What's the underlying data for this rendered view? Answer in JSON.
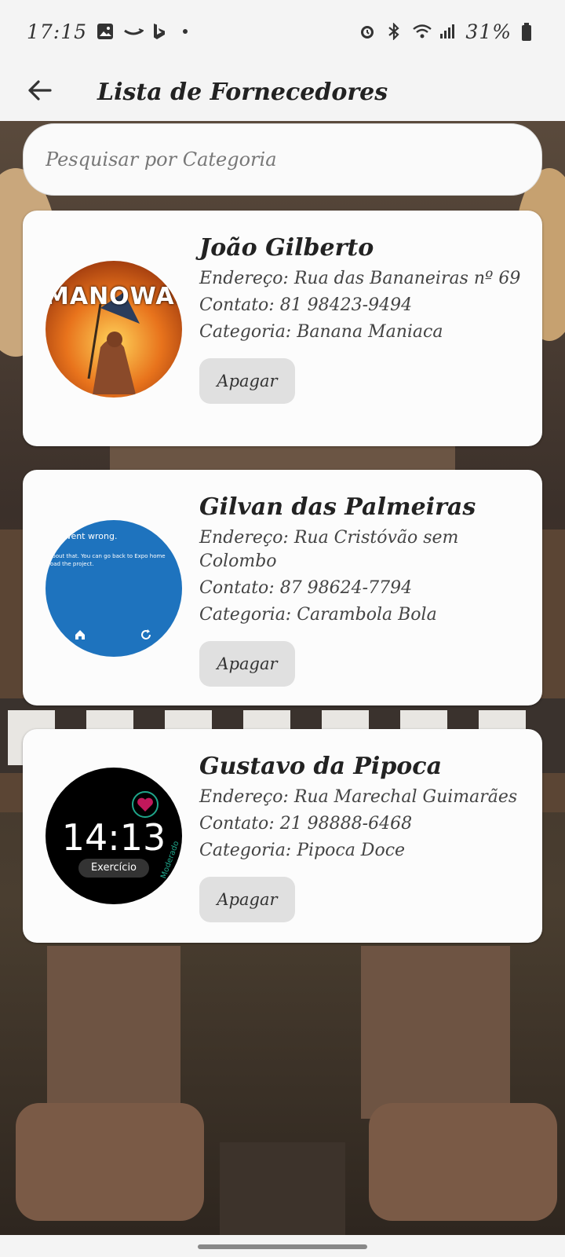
{
  "status_bar": {
    "time": "17:15",
    "battery": "31%",
    "icons_left": [
      "gallery-icon",
      "amazon-icon",
      "bing-icon",
      "dot-icon"
    ],
    "icons_right": [
      "alarm-icon",
      "bluetooth-icon",
      "wifi-icon",
      "signal-icon",
      "battery-icon"
    ]
  },
  "app_bar": {
    "title": "Lista de Fornecedores",
    "back_icon": "arrow-left-icon"
  },
  "search": {
    "placeholder": "Pesquisar por Categoria",
    "value": ""
  },
  "suppliers": [
    {
      "name": "João Gilberto",
      "address": "Endereço: Rua das Bananeiras nº 69",
      "contact": "Contato: 81 98423-9494",
      "category": "Categoria: Banana Maniaca",
      "delete_label": "Apagar",
      "avatar": {
        "logo": "MANOWAR"
      }
    },
    {
      "name": "Gilvan das Palmeiras",
      "address": "Endereço: Rua Cristóvão sem Colombo",
      "contact": "Contato: 87 98624-7794",
      "category": "Categoria: Carambola Bola",
      "delete_label": "Apagar",
      "avatar": {
        "line1": "ng went wrong.",
        "line2": "about that. You can go back to Expo home",
        "line3": "load the project.",
        "color": "#1e73be"
      }
    },
    {
      "name": "Gustavo da Pipoca",
      "address": "Endereço: Rua Marechal Guimarães",
      "contact": "Contato: 21 98888-6468",
      "category": "Categoria: Pipoca Doce",
      "delete_label": "Apagar",
      "avatar": {
        "clock": "14:13",
        "label": "Exercício",
        "side_text": "Moderado"
      }
    }
  ],
  "colors": {
    "bar_bg": "#f4f4f4",
    "card_bg": "#fcfcfc",
    "button_bg": "#e0e0e0"
  }
}
